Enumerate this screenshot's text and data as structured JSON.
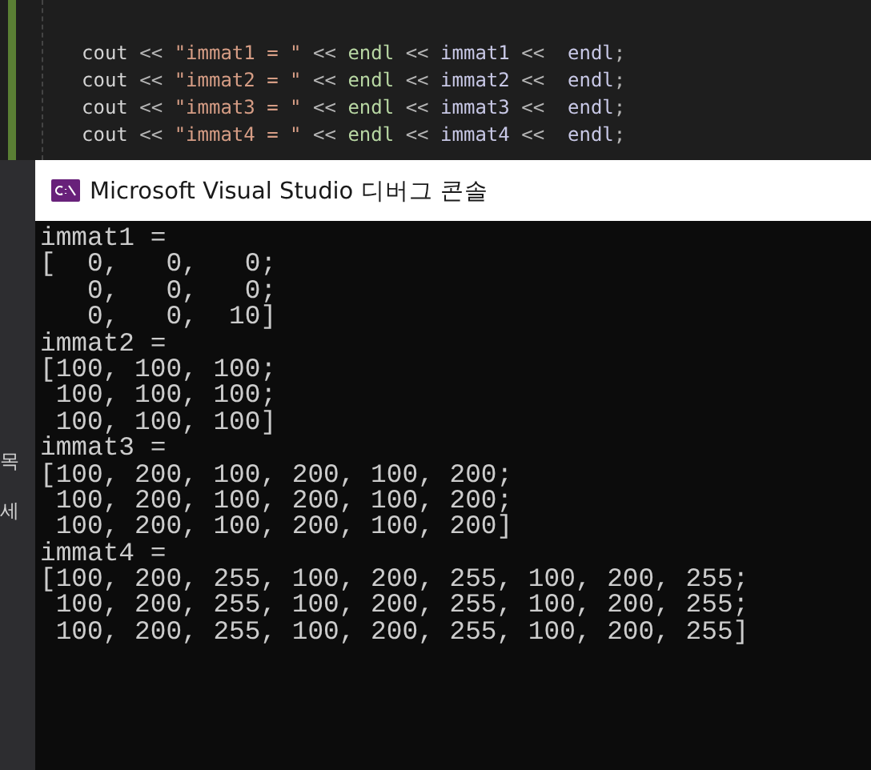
{
  "editor": {
    "code_lines": [
      [
        {
          "kind": "identifier",
          "text": "cout"
        },
        {
          "kind": "operator",
          "text": " << "
        },
        {
          "kind": "string",
          "text": "\"immat1 = \""
        },
        {
          "kind": "operator",
          "text": " << "
        },
        {
          "kind": "function",
          "text": "endl"
        },
        {
          "kind": "operator",
          "text": " << "
        },
        {
          "kind": "variable",
          "text": "immat1"
        },
        {
          "kind": "operator",
          "text": " <<  "
        },
        {
          "kind": "variable",
          "text": "endl"
        },
        {
          "kind": "operator",
          "text": ";"
        }
      ],
      [
        {
          "kind": "identifier",
          "text": "cout"
        },
        {
          "kind": "operator",
          "text": " << "
        },
        {
          "kind": "string",
          "text": "\"immat2 = \""
        },
        {
          "kind": "operator",
          "text": " << "
        },
        {
          "kind": "function",
          "text": "endl"
        },
        {
          "kind": "operator",
          "text": " << "
        },
        {
          "kind": "variable",
          "text": "immat2"
        },
        {
          "kind": "operator",
          "text": " <<  "
        },
        {
          "kind": "variable",
          "text": "endl"
        },
        {
          "kind": "operator",
          "text": ";"
        }
      ],
      [
        {
          "kind": "identifier",
          "text": "cout"
        },
        {
          "kind": "operator",
          "text": " << "
        },
        {
          "kind": "string",
          "text": "\"immat3 = \""
        },
        {
          "kind": "operator",
          "text": " << "
        },
        {
          "kind": "function",
          "text": "endl"
        },
        {
          "kind": "operator",
          "text": " << "
        },
        {
          "kind": "variable",
          "text": "immat3"
        },
        {
          "kind": "operator",
          "text": " <<  "
        },
        {
          "kind": "variable",
          "text": "endl"
        },
        {
          "kind": "operator",
          "text": ";"
        }
      ],
      [
        {
          "kind": "identifier",
          "text": "cout"
        },
        {
          "kind": "operator",
          "text": " << "
        },
        {
          "kind": "string",
          "text": "\"immat4 = \""
        },
        {
          "kind": "operator",
          "text": " << "
        },
        {
          "kind": "function",
          "text": "endl"
        },
        {
          "kind": "operator",
          "text": " << "
        },
        {
          "kind": "variable",
          "text": "immat4"
        },
        {
          "kind": "operator",
          "text": " <<  "
        },
        {
          "kind": "variable",
          "text": "endl"
        },
        {
          "kind": "operator",
          "text": ";"
        }
      ]
    ]
  },
  "side_panel": {
    "labels": [
      "목",
      "세"
    ]
  },
  "console": {
    "title": "Microsoft Visual Studio 디버그 콘솔",
    "lines": [
      "immat1 =",
      "[  0,   0,   0;",
      "   0,   0,   0;",
      "   0,   0,  10]",
      "immat2 =",
      "[100, 100, 100;",
      " 100, 100, 100;",
      " 100, 100, 100]",
      "immat3 =",
      "[100, 200, 100, 200, 100, 200;",
      " 100, 200, 100, 200, 100, 200;",
      " 100, 200, 100, 200, 100, 200]",
      "immat4 =",
      "[100, 200, 255, 100, 200, 255, 100, 200, 255;",
      " 100, 200, 255, 100, 200, 255, 100, 200, 255;",
      " 100, 200, 255, 100, 200, 255, 100, 200, 255]"
    ]
  }
}
